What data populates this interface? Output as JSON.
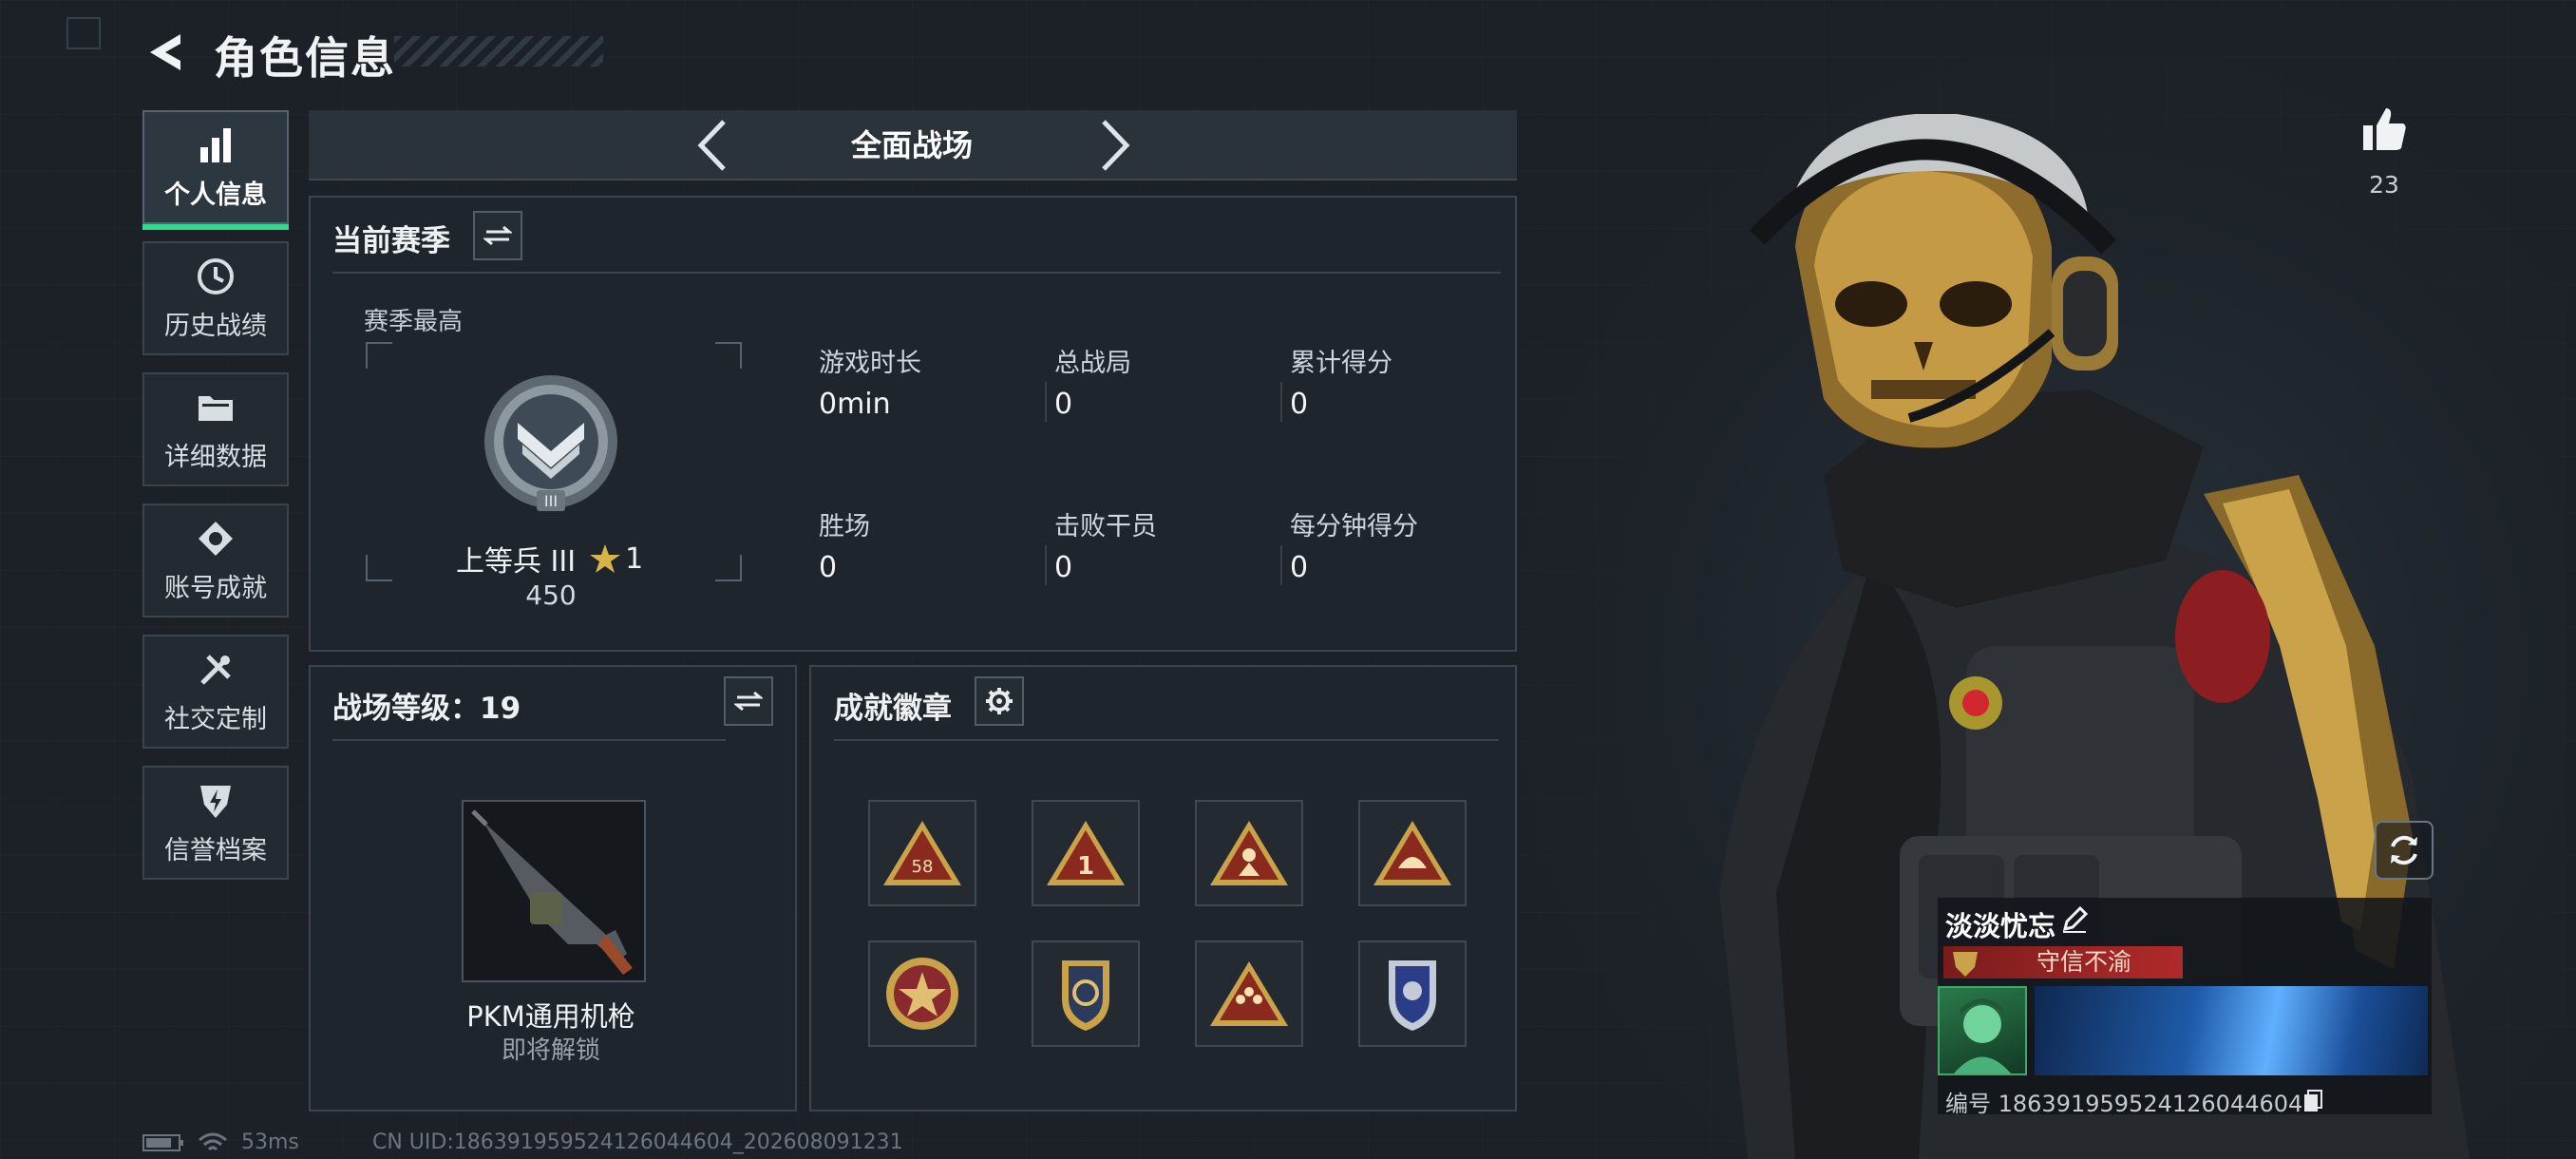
{
  "header": {
    "title": "角色信息"
  },
  "sidebar": {
    "items": [
      {
        "label": "个人信息",
        "icon": "bar-chart-icon",
        "active": true
      },
      {
        "label": "历史战绩",
        "icon": "history-clock-icon",
        "active": false
      },
      {
        "label": "详细数据",
        "icon": "folder-icon",
        "active": false
      },
      {
        "label": "账号成就",
        "icon": "medal-icon",
        "active": false
      },
      {
        "label": "社交定制",
        "icon": "tools-icon",
        "active": false
      },
      {
        "label": "信誉档案",
        "icon": "shield-bolt-icon",
        "active": false
      }
    ]
  },
  "mode_switcher": {
    "label": "全面战场"
  },
  "season": {
    "title": "当前赛季",
    "best_label": "赛季最高",
    "rank_name": "上等兵 III",
    "rank_stars": "1",
    "rank_points": "450",
    "stats": [
      {
        "label": "游戏时长",
        "value": "0min"
      },
      {
        "label": "总战局",
        "value": "0"
      },
      {
        "label": "累计得分",
        "value": "0"
      },
      {
        "label": "胜场",
        "value": "0"
      },
      {
        "label": "击败干员",
        "value": "0"
      },
      {
        "label": "每分钟得分",
        "value": "0"
      }
    ]
  },
  "battlefield_level": {
    "title": "战场等级：19",
    "weapon_name": "PKM通用机枪",
    "weapon_status": "即将解锁"
  },
  "achievements": {
    "title": "成就徽章",
    "badges": [
      {
        "icon": "triangle-badge-58-icon",
        "text": "58"
      },
      {
        "icon": "triangle-badge-1-icon",
        "text": "1"
      },
      {
        "icon": "triangle-badge-soldier-icon",
        "text": ""
      },
      {
        "icon": "triangle-badge-helmet-icon",
        "text": ""
      },
      {
        "icon": "round-star-badge-icon",
        "text": ""
      },
      {
        "icon": "shield-wing-badge-icon",
        "text": ""
      },
      {
        "icon": "triangle-badge-squad-icon",
        "text": ""
      },
      {
        "icon": "blue-shield-badge-icon",
        "text": ""
      }
    ]
  },
  "profile": {
    "likes": "23",
    "player_name": "淡淡忧忘",
    "honor_title": "守信不渝",
    "player_id": "编号 186391959524126044604"
  },
  "footer": {
    "ping": "53ms",
    "uid": "CN UID:186391959524126044604_202608091231"
  },
  "colors": {
    "accent": "#32d98d",
    "honor": "#b02a2a",
    "gold": "#c9a24a"
  }
}
